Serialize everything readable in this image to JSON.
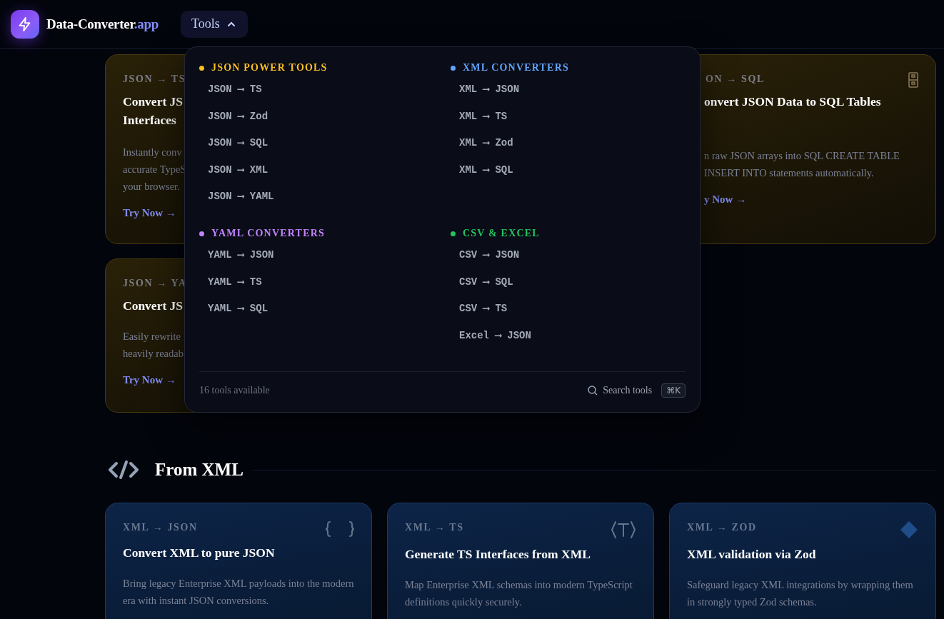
{
  "brand": {
    "name": "Data-Converter",
    "suffix": ".app"
  },
  "nav": {
    "label": "Tools",
    "expanded": true
  },
  "top_cards": [
    {
      "label": "JSON → TS",
      "title": [
        "Convert JS",
        "Interfaces"
      ],
      "description": [
        "Instantly conv",
        "accurate TypeS",
        "your browser."
      ],
      "link": "Try Now →"
    },
    {
      "label": "ON → SQL",
      "title": [
        "onvert JSON Data to SQL Tables"
      ],
      "description": [
        "n raw JSON arrays into SQL CREATE TABLE",
        "INSERT INTO statements automatically."
      ],
      "link": "y Now →"
    },
    {
      "label": "JSON → YA",
      "title": [
        "Convert JS"
      ],
      "description": [
        "Easily rewrite",
        "heavily readab"
      ],
      "link": "Try Now →"
    }
  ],
  "menu": {
    "groups": [
      {
        "title": "JSON POWER TOOLS",
        "color": "#fbbf24",
        "items": [
          "JSON ⟶ TS",
          "JSON ⟶ Zod",
          "JSON ⟶ SQL",
          "JSON ⟶ XML",
          "JSON ⟶ YAML"
        ]
      },
      {
        "title": "XML CONVERTERS",
        "color": "#60a5fa",
        "items": [
          "XML ⟶ JSON",
          "XML ⟶ TS",
          "XML ⟶ Zod",
          "XML ⟶ SQL"
        ]
      },
      {
        "title": "YAML CONVERTERS",
        "color": "#c084fc",
        "items": [
          "YAML ⟶ JSON",
          "YAML ⟶ TS",
          "YAML ⟶ SQL"
        ]
      },
      {
        "title": "CSV & EXCEL",
        "color": "#22c55e",
        "items": [
          "CSV ⟶ JSON",
          "CSV ⟶ SQL",
          "CSV ⟶ TS",
          "Excel ⟶ JSON"
        ]
      }
    ],
    "footer": {
      "count": "16 tools available",
      "search": "Search tools",
      "shortcut": "⌘K"
    }
  },
  "section": {
    "title": "From XML",
    "cards": [
      {
        "label": "XML → JSON",
        "title": "Convert XML to pure JSON",
        "description": "Bring legacy Enterprise XML payloads into the modern era with instant JSON conversions."
      },
      {
        "label": "XML → TS",
        "title": "Generate TS Interfaces from XML",
        "description": "Map Enterprise XML schemas into modern TypeScript definitions quickly securely."
      },
      {
        "label": "XML → ZOD",
        "title": "XML validation via Zod",
        "description": "Safeguard legacy XML integrations by wrapping them in strongly typed Zod schemas."
      }
    ]
  }
}
